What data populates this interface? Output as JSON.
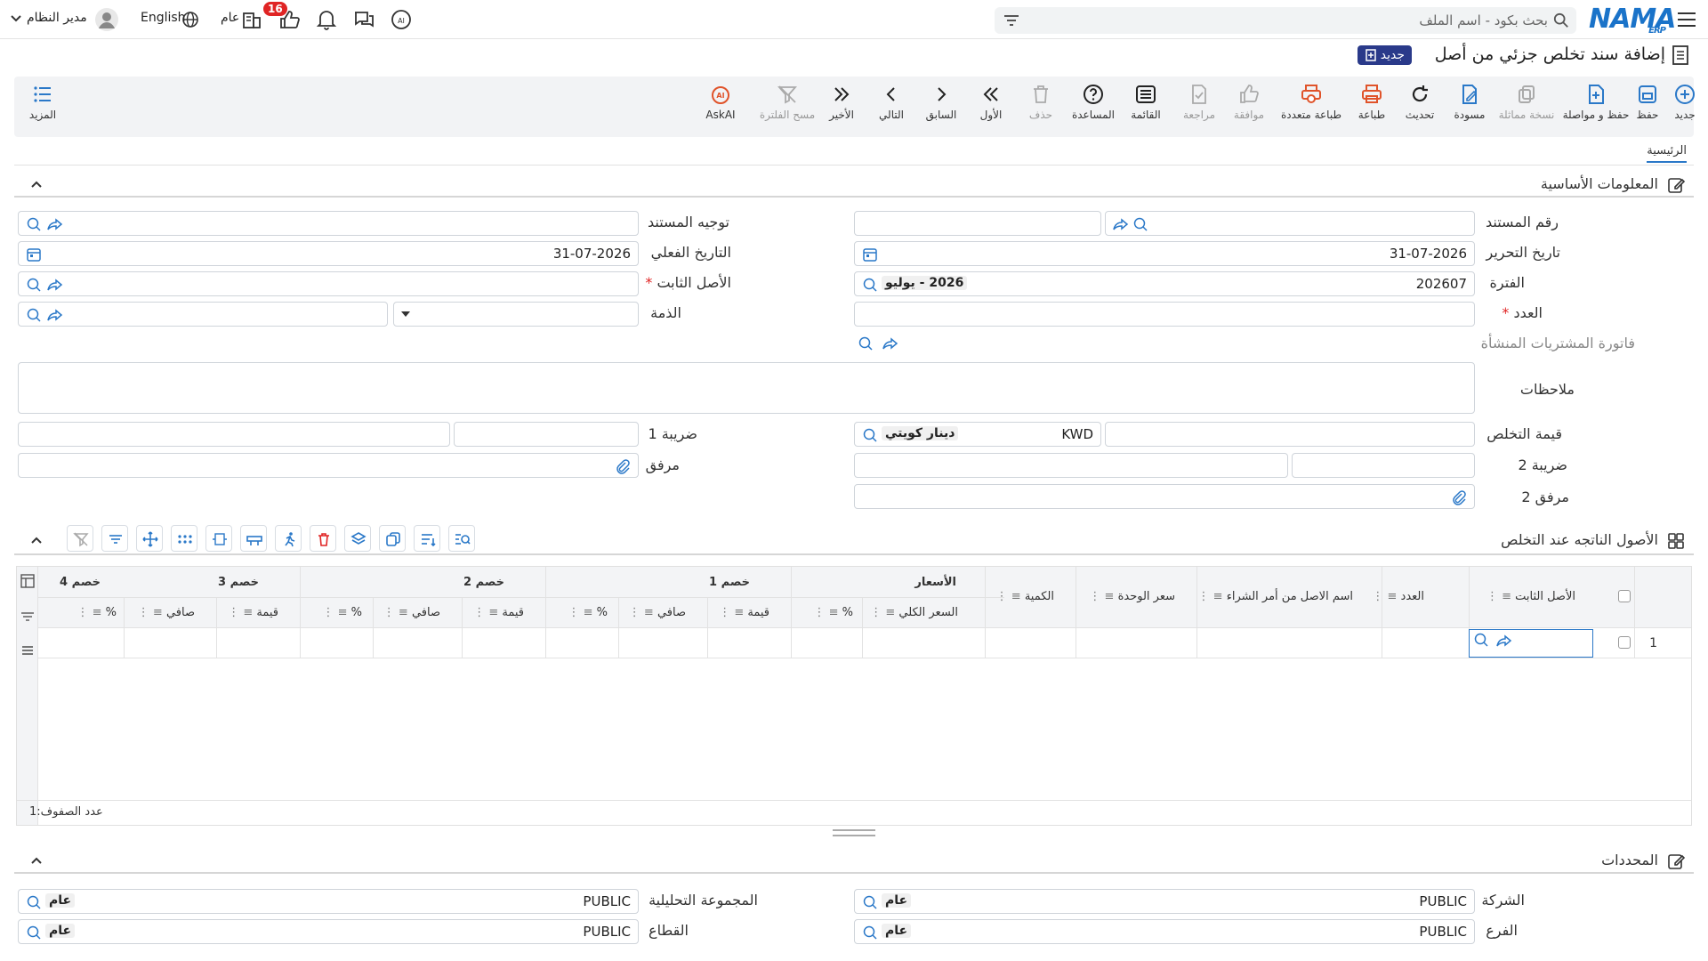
{
  "topbar": {
    "search_placeholder": "بحث بكود - اسم الملف",
    "user_name": "مدير النظام",
    "language": "English",
    "scope": "عام",
    "notif_count": "16",
    "logo_text": "NAMA",
    "logo_sub": "ERP"
  },
  "page": {
    "title": "إضافة سند تخلص جزئي من أصل",
    "new_badge": "جديد"
  },
  "toolbar": {
    "items": [
      {
        "label": "جديد",
        "icon": "plus-circle-icon"
      },
      {
        "label": "حفظ",
        "icon": "save-icon"
      },
      {
        "label": "حفظ و مواصلة",
        "icon": "save-continue-icon"
      },
      {
        "label": "نسخة مماثلة",
        "icon": "copy-icon"
      },
      {
        "label": "مسودة",
        "icon": "draft-icon"
      },
      {
        "label": "تحديث",
        "icon": "refresh-icon"
      },
      {
        "label": "طباعة",
        "icon": "print-icon"
      },
      {
        "label": "طباعة متعددة",
        "icon": "multi-print-icon"
      },
      {
        "label": "موافقة",
        "icon": "approve-icon"
      },
      {
        "label": "مراجعة",
        "icon": "review-icon"
      },
      {
        "label": "القائمة",
        "icon": "list-icon"
      },
      {
        "label": "المساعدة",
        "icon": "help-icon"
      },
      {
        "label": "حذف",
        "icon": "delete-icon"
      },
      {
        "label": "الأول",
        "icon": "first-icon"
      },
      {
        "label": "السابق",
        "icon": "previous-icon"
      },
      {
        "label": "التالي",
        "icon": "next-icon"
      },
      {
        "label": "الأخير",
        "icon": "last-icon"
      },
      {
        "label": "مسح الفلترة",
        "icon": "clear-filter-icon"
      },
      {
        "label": "AskAI",
        "icon": "ask-ai-icon"
      }
    ],
    "more": "المزيد"
  },
  "tabs": {
    "main": "الرئيسية"
  },
  "basic": {
    "title": "المعلومات الأساسية",
    "doc_number": "رقم المستند",
    "doc_direction": "توجيه المستند",
    "write_date": "تاريخ التحرير",
    "write_date_val": "31-07-2026",
    "actual_date": "التاريخ الفعلي",
    "actual_date_val": "31-07-2026",
    "period": "الفترة",
    "period_val": "202607",
    "period_tag": "2026 - يوليو",
    "fixed_asset": "الأصل الثابت",
    "count": "العدد",
    "liability": "الذمة",
    "purchase_invoice": "فاتورة المشتريات المنشأة",
    "notes": "ملاحظات",
    "disposal_value": "قيمة التخلص",
    "currency_code": "KWD",
    "currency_name": "دينار كويتي",
    "tax1": "ضريبة 1",
    "tax2": "ضريبة 2",
    "attachment": "مرفق",
    "attachment2": "مرفق 2"
  },
  "assets": {
    "title": "الأصول الناتجه عند التخلص",
    "columns": {
      "fixed_asset": "الأصل الثابت",
      "count": "العدد",
      "po_asset_name": "اسم الاصل من أمر الشراء",
      "unit_price": "سعر الوحدة",
      "quantity": "الكمية",
      "prices": "الأسعار",
      "total_price": "السعر الكلي",
      "discount1": "خصم 1",
      "discount2": "خصم 2",
      "discount3": "خصم 3",
      "discount4": "خصم 4",
      "pct": "%",
      "value": "قيمة",
      "net": "صافي"
    },
    "row_number": "1",
    "row_count_label": "عدد الصفوف:",
    "row_count": "1"
  },
  "dims": {
    "title": "المحددات",
    "company": "الشركة",
    "company_val": "PUBLIC",
    "company_tag": "عام",
    "analytic_group": "المجموعة التحليلية",
    "analytic_val": "PUBLIC",
    "analytic_tag": "عام",
    "branch": "الفرع",
    "branch_val": "PUBLIC",
    "branch_tag": "عام",
    "sector": "القطاع",
    "sector_val": "PUBLIC",
    "sector_tag": "عام"
  }
}
